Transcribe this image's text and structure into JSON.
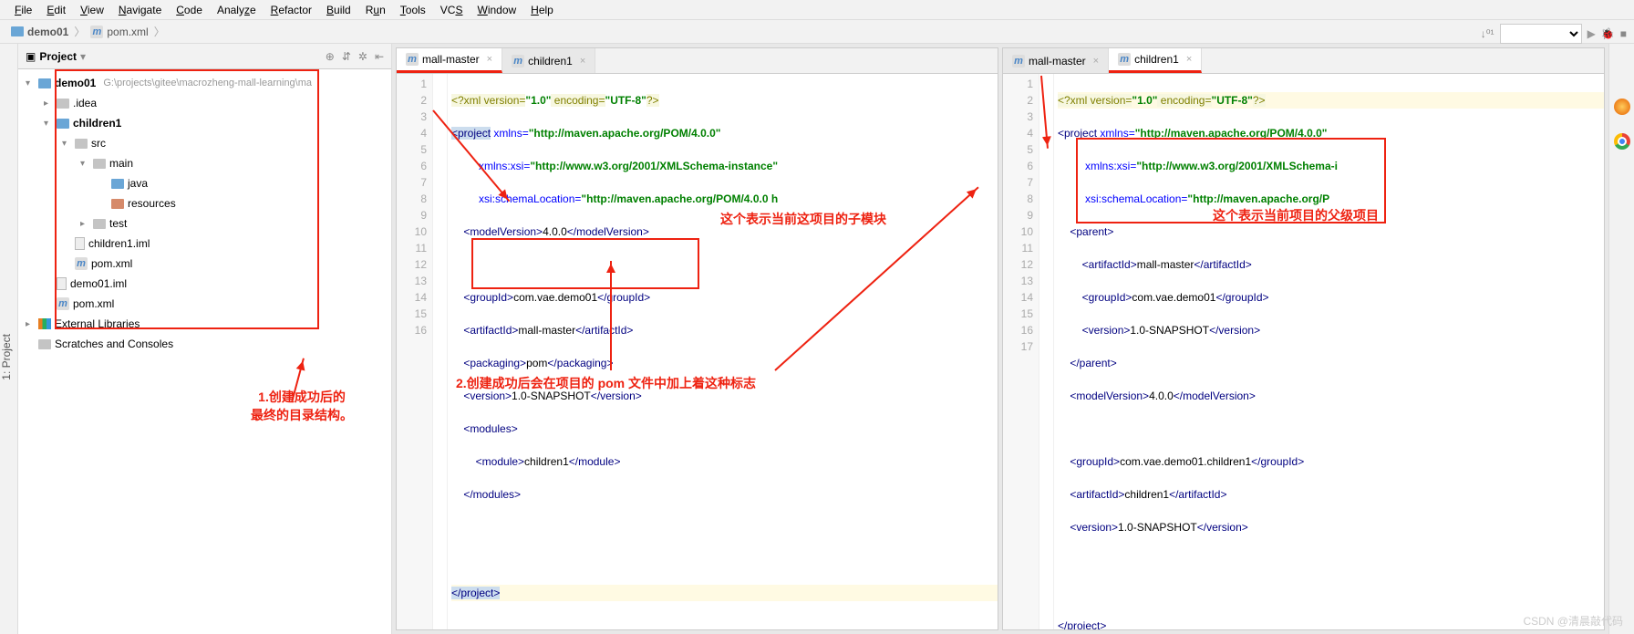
{
  "menu": [
    "File",
    "Edit",
    "View",
    "Navigate",
    "Code",
    "Analyze",
    "Refactor",
    "Build",
    "Run",
    "Tools",
    "VCS",
    "Window",
    "Help"
  ],
  "breadcrumb": {
    "project": "demo01",
    "file": "pom.xml"
  },
  "panel_title": "Project",
  "tree": {
    "root": "demo01",
    "root_path": "G:\\projects\\gitee\\macrozheng-mall-learning\\ma",
    "idea": ".idea",
    "children1": "children1",
    "src": "src",
    "main": "main",
    "java": "java",
    "resources": "resources",
    "test": "test",
    "children1_iml": "children1.iml",
    "pom1": "pom.xml",
    "demo01_iml": "demo01.iml",
    "pom2": "pom.xml",
    "ext_lib": "External Libraries",
    "scratches": "Scratches and Consoles"
  },
  "tabs_left": {
    "t1": "mall-master",
    "t2": "children1"
  },
  "tabs_right": {
    "t1": "mall-master",
    "t2": "children1"
  },
  "editor_left_lines": [
    "1",
    "2",
    "3",
    "4",
    "5",
    "6",
    "7",
    "8",
    "9",
    "10",
    "11",
    "12",
    "13",
    "14",
    "15",
    "16"
  ],
  "editor_right_lines": [
    "1",
    "2",
    "3",
    "4",
    "5",
    "6",
    "7",
    "8",
    "9",
    "10",
    "11",
    "12",
    "13",
    "14",
    "15",
    "16",
    "17"
  ],
  "code_left": {
    "l1": "<?xml version=\"1.0\" encoding=\"UTF-8\"?>",
    "l2a": "<project ",
    "l2b": "xmlns=",
    "l2c": "\"http://maven.apache.org/POM/4.0.0\"",
    "l3a": "         xmlns:xsi=",
    "l3b": "\"http://www.w3.org/2001/XMLSchema-instance\"",
    "l4a": "         xsi:schemaLocation=",
    "l4b": "\"http://maven.apache.org/POM/4.0.0 h",
    "l5": "    <modelVersion>4.0.0</modelVersion>",
    "l7": "    <groupId>com.vae.demo01</groupId>",
    "l8": "    <artifactId>mall-master</artifactId>",
    "l9": "    <packaging>pom</packaging>",
    "l10": "    <version>1.0-SNAPSHOT</version>",
    "l11": "    <modules>",
    "l12": "        <module>children1</module>",
    "l13": "    </modules>",
    "l16": "</project>"
  },
  "code_right": {
    "l1": "<?xml version=\"1.0\" encoding=\"UTF-8\"?>",
    "l2a": "<project ",
    "l2b": "xmlns=",
    "l2c": "\"http://maven.apache.org/POM/4.0.0\"",
    "l3a": "         xmlns:xsi=",
    "l3b": "\"http://www.w3.org/2001/XMLSchema-i",
    "l4a": "         xsi:schemaLocation=",
    "l4b": "\"http://maven.apache.org/P",
    "l5": "    <parent>",
    "l6": "        <artifactId>mall-master</artifactId>",
    "l7": "        <groupId>com.vae.demo01</groupId>",
    "l8": "        <version>1.0-SNAPSHOT</version>",
    "l9": "    </parent>",
    "l10": "    <modelVersion>4.0.0</modelVersion>",
    "l12": "    <groupId>com.vae.demo01.children1</groupId>",
    "l13": "    <artifactId>children1</artifactId>",
    "l14": "    <version>1.0-SNAPSHOT</version>",
    "l17": "</project>"
  },
  "annotations": {
    "a1": "1.创建成功后的\n最终的目录结构。",
    "a2": "2.创建成功后会在项目的 pom 文件中加上着这种标志",
    "a3": "这个表示当前这项目的子模块",
    "a4": "这个表示当前项目的父级项目"
  },
  "watermark": "CSDN @清晨敲代码"
}
